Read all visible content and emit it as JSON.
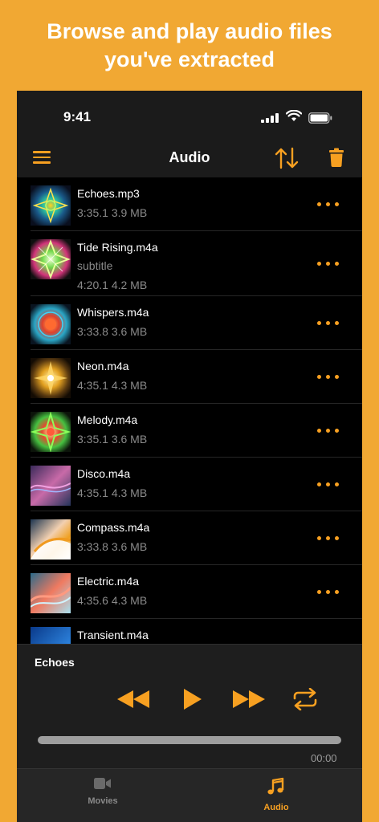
{
  "promo": {
    "line1": "Browse and play audio files",
    "line2": "you've extracted"
  },
  "status_bar": {
    "time": "9:41"
  },
  "nav": {
    "title": "Audio",
    "menu_icon": "hamburger-menu-icon",
    "sort_icon": "sort-arrows-icon",
    "delete_icon": "trash-icon"
  },
  "colors": {
    "accent": "#F7A021",
    "background": "#F1A833",
    "panel": "#1B1B1B"
  },
  "files": [
    {
      "name": "Echoes.mp3",
      "duration": "3:35.1",
      "size": "3.9 MB"
    },
    {
      "name": "Tide Rising.m4a",
      "subtitle": "subtitle",
      "duration": "4:20.1",
      "size": "4.2 MB"
    },
    {
      "name": "Whispers.m4a",
      "duration": "3:33.8",
      "size": "3.6 MB"
    },
    {
      "name": "Neon.m4a",
      "duration": "4:35.1",
      "size": "4.3 MB"
    },
    {
      "name": "Melody.m4a",
      "duration": "3:35.1",
      "size": "3.6 MB"
    },
    {
      "name": "Disco.m4a",
      "duration": "4:35.1",
      "size": "4.3 MB"
    },
    {
      "name": "Compass.m4a",
      "duration": "3:33.8",
      "size": "3.6 MB"
    },
    {
      "name": "Electric.m4a",
      "duration": "4:35.6",
      "size": "4.3 MB"
    },
    {
      "name": "Transient.m4a"
    }
  ],
  "player": {
    "now_playing": "Echoes",
    "elapsed": "00:00",
    "progress": 0
  },
  "tabs": [
    {
      "label": "Movies",
      "icon": "video-camera-icon",
      "selected": false
    },
    {
      "label": "Audio",
      "icon": "music-note-icon",
      "selected": true
    }
  ]
}
